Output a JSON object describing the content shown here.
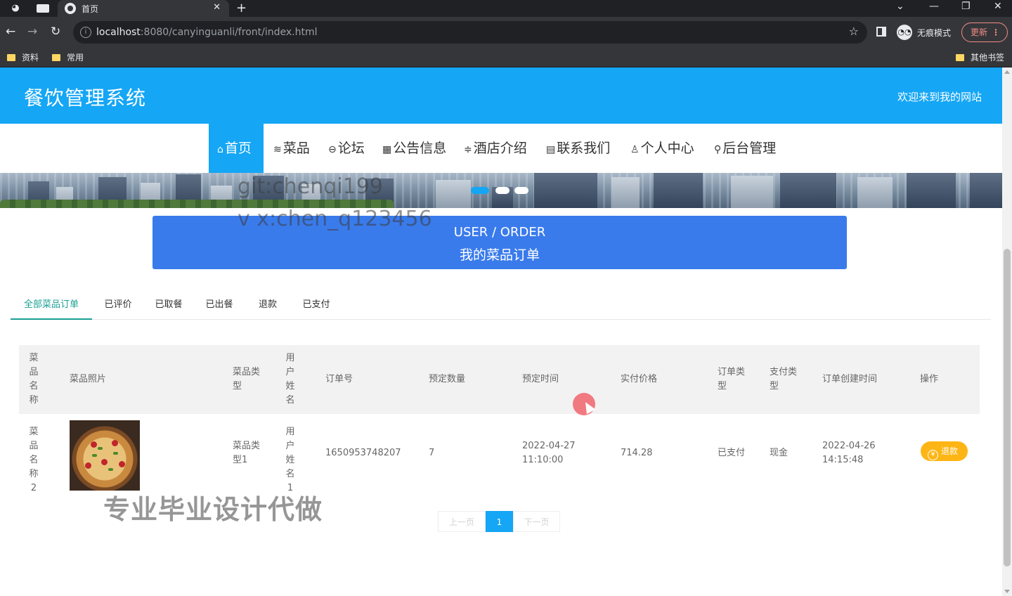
{
  "browser": {
    "tab_title": "首页",
    "url_host": "localhost",
    "url_rest": ":8080/canyinguanli/front/index.html",
    "incognito_label": "无痕模式",
    "update_label": "更新",
    "bookmarks": [
      "资料",
      "常用"
    ],
    "other_bookmarks": "其他书签"
  },
  "site": {
    "title": "餐饮管理系统",
    "welcome": "欢迎来到我的网站"
  },
  "nav": [
    {
      "icon": "⌂",
      "label": "首页"
    },
    {
      "icon": "≋",
      "label": "菜品"
    },
    {
      "icon": "⊖",
      "label": "论坛"
    },
    {
      "icon": "▦",
      "label": "公告信息"
    },
    {
      "icon": "≑",
      "label": "酒店介绍"
    },
    {
      "icon": "▤",
      "label": "联系我们"
    },
    {
      "icon": "♙",
      "label": "个人中心"
    },
    {
      "icon": "⚲",
      "label": "后台管理"
    }
  ],
  "watermark": {
    "line1": "git:chenqi199",
    "line2": "v x:chen_q123456",
    "line3": "专业毕业设计代做"
  },
  "order_banner": {
    "en": "USER / ORDER",
    "cn": "我的菜品订单"
  },
  "filter_tabs": [
    "全部菜品订单",
    "已评价",
    "已取餐",
    "已出餐",
    "退款",
    "已支付"
  ],
  "table": {
    "headers": [
      "菜品名称",
      "菜品照片",
      "菜品类型",
      "用户姓名",
      "订单号",
      "预定数量",
      "预定时间",
      "实付价格",
      "订单类型",
      "支付类型",
      "订单创建时间",
      "操作"
    ],
    "rows": [
      {
        "name": "菜品名称2",
        "type": "菜品类型1",
        "user": "用户姓名1",
        "order_no": "1650953748207",
        "qty": "7",
        "reserve_date": "2022-04-27",
        "reserve_time": "11:10:00",
        "price": "714.28",
        "order_type": "已支付",
        "pay_type": "现金",
        "created_date": "2022-04-26",
        "created_time": "14:15:48",
        "action": "退款"
      }
    ]
  },
  "pager": {
    "prev": "上一页",
    "current": "1",
    "next": "下一页"
  }
}
